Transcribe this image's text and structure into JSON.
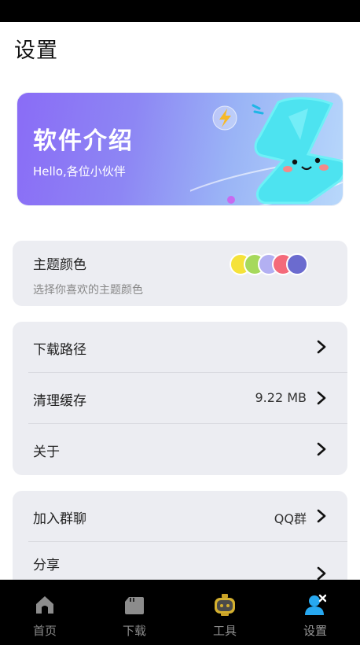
{
  "page": {
    "title": "设置"
  },
  "banner": {
    "title": "软件介绍",
    "subtitle": "Hello,各位小伙伴"
  },
  "theme": {
    "title": "主题颜色",
    "subtitle": "选择你喜欢的主题颜色",
    "swatch_colors": [
      "#f5e23a",
      "#a6d95c",
      "#b3b0f2",
      "#f46a7a",
      "#6b6bcf"
    ]
  },
  "settings": {
    "download_path": {
      "label": "下载路径"
    },
    "clear_cache": {
      "label": "清理缓存",
      "value": "9.22 MB"
    },
    "about": {
      "label": "关于"
    }
  },
  "social": {
    "join_group": {
      "label": "加入群聊",
      "value": "QQ群"
    },
    "share": {
      "label": "分享"
    }
  },
  "nav": {
    "items": [
      {
        "label": "首页",
        "icon": "home-icon"
      },
      {
        "label": "下载",
        "icon": "download-icon"
      },
      {
        "label": "工具",
        "icon": "tools-icon"
      },
      {
        "label": "设置",
        "icon": "settings-user-icon"
      }
    ],
    "active_index": 3,
    "accent_color": "#27a8f0"
  }
}
